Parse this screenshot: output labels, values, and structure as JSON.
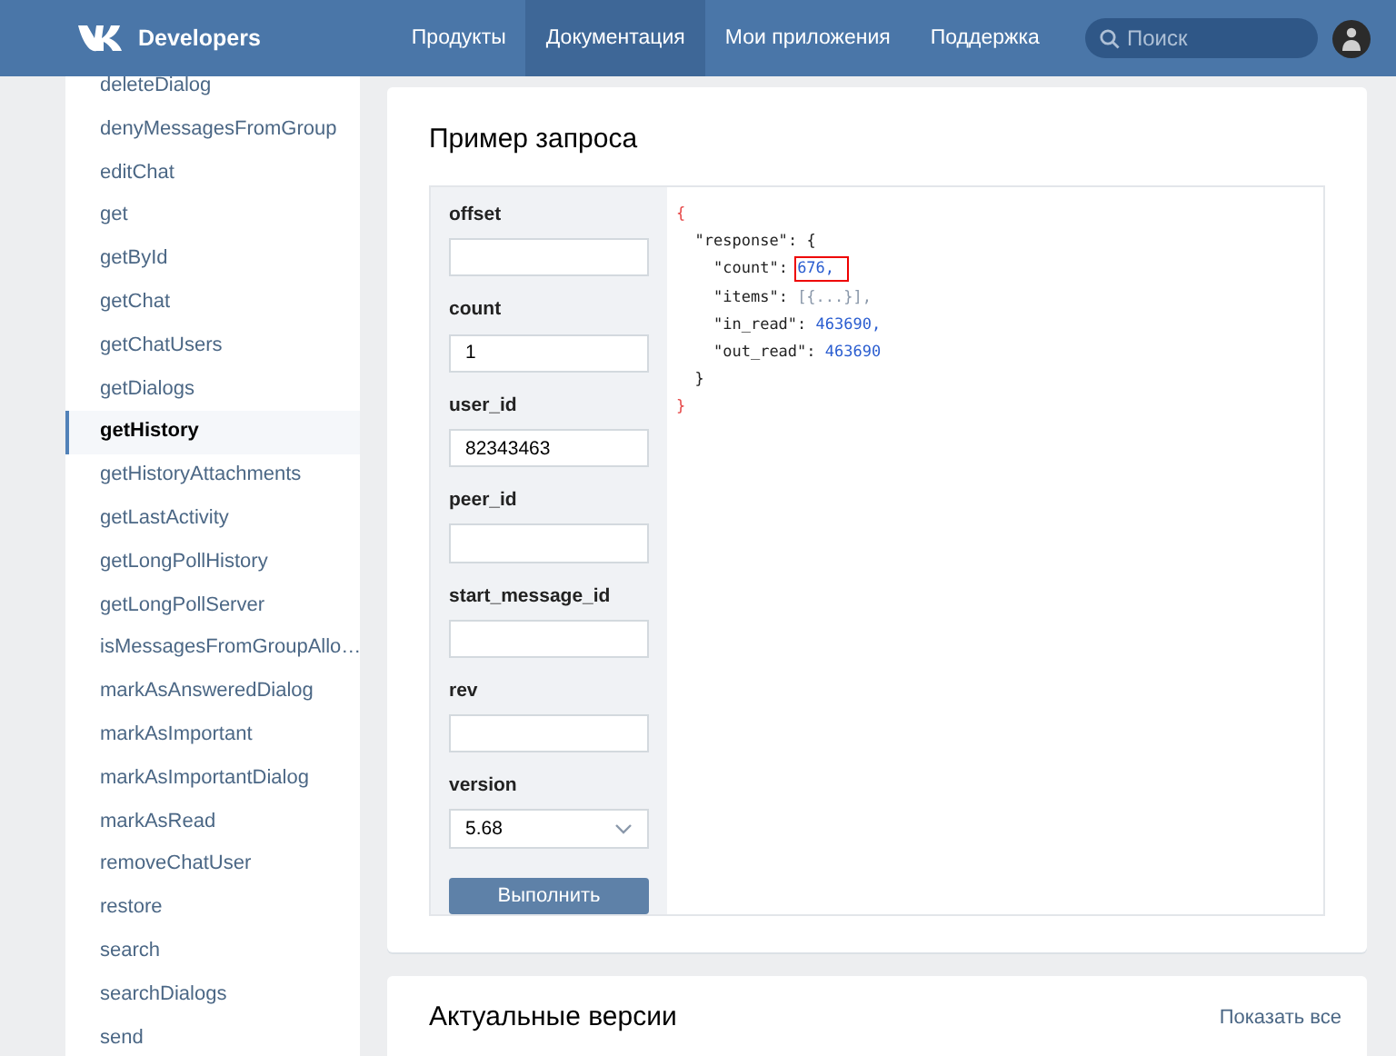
{
  "header": {
    "brand": "Developers",
    "nav": [
      {
        "label": "Продукты",
        "selected": false
      },
      {
        "label": "Документация",
        "selected": true
      },
      {
        "label": "Мои приложения",
        "selected": false
      },
      {
        "label": "Поддержка",
        "selected": false
      }
    ],
    "search": {
      "placeholder": "Поиск"
    }
  },
  "sidebar": {
    "items": [
      {
        "label": "deleteDialog",
        "selected": false
      },
      {
        "label": "denyMessagesFromGroup",
        "selected": false
      },
      {
        "label": "editChat",
        "selected": false
      },
      {
        "label": "get",
        "selected": false
      },
      {
        "label": "getById",
        "selected": false
      },
      {
        "label": "getChat",
        "selected": false
      },
      {
        "label": "getChatUsers",
        "selected": false
      },
      {
        "label": "getDialogs",
        "selected": false
      },
      {
        "label": "getHistory",
        "selected": true
      },
      {
        "label": "getHistoryAttachments",
        "selected": false
      },
      {
        "label": "getLastActivity",
        "selected": false
      },
      {
        "label": "getLongPollHistory",
        "selected": false
      },
      {
        "label": "getLongPollServer",
        "selected": false
      },
      {
        "label": "isMessagesFromGroupAllo…",
        "selected": false
      },
      {
        "label": "markAsAnsweredDialog",
        "selected": false
      },
      {
        "label": "markAsImportant",
        "selected": false
      },
      {
        "label": "markAsImportantDialog",
        "selected": false
      },
      {
        "label": "markAsRead",
        "selected": false
      },
      {
        "label": "removeChatUser",
        "selected": false
      },
      {
        "label": "restore",
        "selected": false
      },
      {
        "label": "search",
        "selected": false
      },
      {
        "label": "searchDialogs",
        "selected": false
      },
      {
        "label": "send",
        "selected": false
      }
    ]
  },
  "request_card": {
    "title": "Пример запроса",
    "fields": [
      {
        "label": "offset",
        "kind": "text"
      },
      {
        "label": "count",
        "kind": "text",
        "value": "1"
      },
      {
        "label": "user_id",
        "kind": "text",
        "value": "82343463"
      },
      {
        "label": "peer_id",
        "kind": "text"
      },
      {
        "label": "start_message_id",
        "kind": "text"
      },
      {
        "label": "rev",
        "kind": "text"
      },
      {
        "label": "version",
        "kind": "select",
        "value": "5.68"
      }
    ],
    "run_button": "Выполнить",
    "code": {
      "open": "{",
      "close": "}",
      "children": [
        {
          "key": "\"response\"",
          "colon": ": ",
          "open": "{",
          "close": "}",
          "children": [
            {
              "key": "\"count\"",
              "colon": ": ",
              "value": "676,",
              "kind": "number",
              "highlighted": true
            },
            {
              "key": "\"items\"",
              "colon": ": ",
              "value": "[{...}],",
              "kind": "collapsed",
              "highlighted": false
            },
            {
              "key": "\"in_read\"",
              "colon": ": ",
              "value": "463690,",
              "kind": "number",
              "highlighted": false
            },
            {
              "key": "\"out_read\"",
              "colon": ": ",
              "value": "463690",
              "kind": "number",
              "highlighted": false
            }
          ]
        }
      ]
    }
  },
  "versions_card": {
    "title": "Актуальные версии",
    "link": "Показать все"
  }
}
